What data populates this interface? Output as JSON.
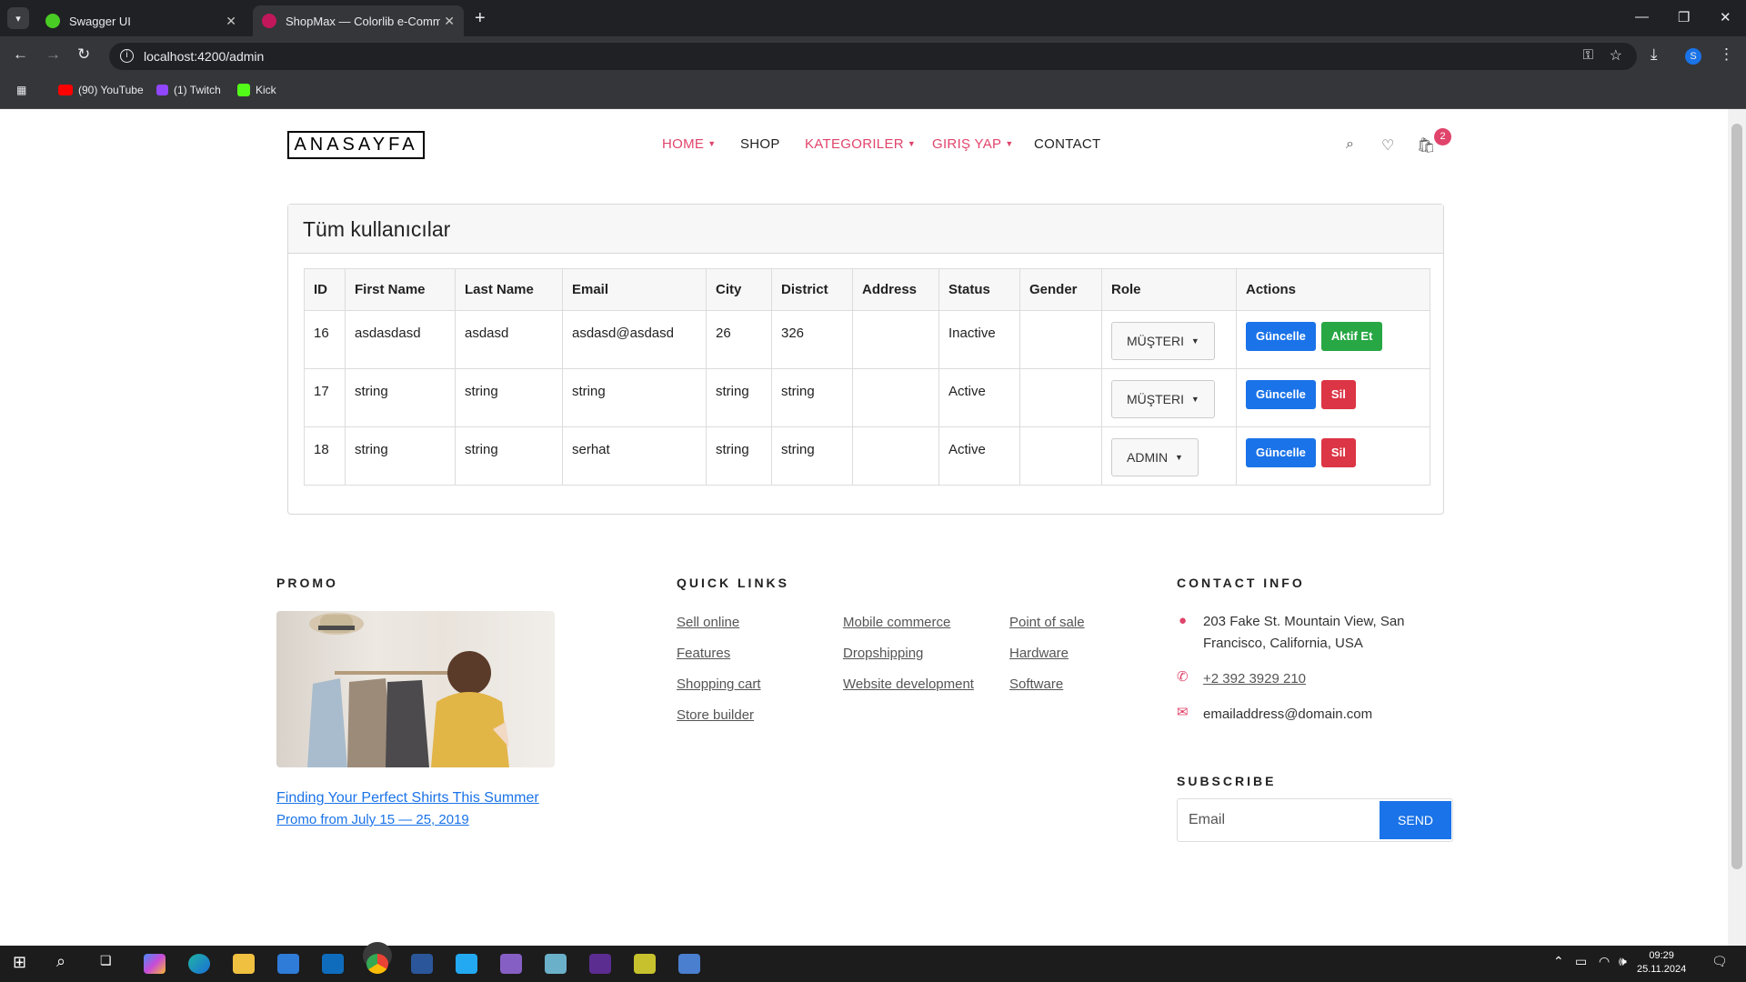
{
  "browser": {
    "tabs": [
      {
        "label": "Swagger UI",
        "color": "#49cc24"
      },
      {
        "label": "ShopMax — Colorlib e-Comme",
        "color": "#c2185b"
      }
    ],
    "url": "localhost:4200/admin",
    "profile": "S",
    "bookmarks": [
      {
        "label": "(90) YouTube",
        "color": "#ff0000"
      },
      {
        "label": "(1) Twitch",
        "color": "#9146ff"
      },
      {
        "label": "Kick",
        "color": "#53fc18"
      }
    ]
  },
  "site": {
    "logo": "ANASAYFA",
    "nav": {
      "home": "HOME",
      "shop": "SHOP",
      "categories": "KATEGORILER",
      "login": "GIRIŞ YAP",
      "contact": "CONTACT"
    },
    "cart_count": "2"
  },
  "users": {
    "title": "Tüm kullanıcılar",
    "columns": [
      "ID",
      "First Name",
      "Last Name",
      "Email",
      "City",
      "District",
      "Address",
      "Status",
      "Gender",
      "Role",
      "Actions"
    ],
    "rows": [
      {
        "id": "16",
        "first": "asdasdasd",
        "last": "asdasd",
        "email": "asdasd@asdasd",
        "city": "26",
        "district": "326",
        "address": "",
        "status": "Inactive",
        "gender": "",
        "role": "MÜŞTERI",
        "primary": "Güncelle",
        "secondary": "Aktif Et"
      },
      {
        "id": "17",
        "first": "string",
        "last": "string",
        "email": "string",
        "city": "string",
        "district": "string",
        "address": "",
        "status": "Active",
        "gender": "",
        "role": "MÜŞTERI",
        "primary": "Güncelle",
        "secondary": "Sil"
      },
      {
        "id": "18",
        "first": "string",
        "last": "string",
        "email": "serhat",
        "city": "string",
        "district": "string",
        "address": "",
        "status": "Active",
        "gender": "",
        "role": "ADMIN",
        "primary": "Güncelle",
        "secondary": "Sil"
      }
    ]
  },
  "footer": {
    "promo_title": "PROMO",
    "promo_link": "Finding Your Perfect Shirts This Summer",
    "promo_date": "Promo from July 15 — 25, 2019",
    "quick_links_title": "QUICK LINKS",
    "links_col1": [
      "Sell online",
      "Features",
      "Shopping cart",
      "Store builder"
    ],
    "links_col2": [
      "Mobile commerce",
      "Dropshipping",
      "Website development"
    ],
    "links_col3": [
      "Point of sale",
      "Hardware",
      "Software"
    ],
    "contact_title": "CONTACT INFO",
    "address_line1": "203 Fake St. Mountain View, San",
    "address_line2": "Francisco, California, USA",
    "phone": "+2 392 3929 210",
    "email": "emailaddress@domain.com",
    "subscribe_title": "SUBSCRIBE",
    "subscribe_placeholder": "Email",
    "send": "SEND"
  },
  "taskbar": {
    "time": "09:29",
    "date": "25.11.2024"
  }
}
